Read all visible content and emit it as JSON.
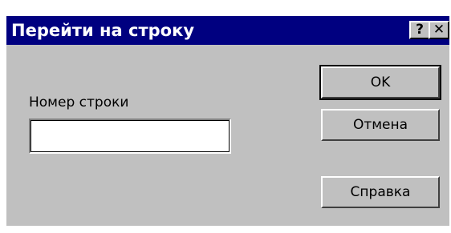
{
  "window": {
    "title": "Перейти на строку",
    "help_button": "?",
    "close_button": "✕"
  },
  "form": {
    "line_number_label": "Номер строки",
    "line_number_value": ""
  },
  "buttons": {
    "ok": "OK",
    "cancel": "Отмена",
    "help": "Справка"
  },
  "colors": {
    "titlebar": "#000080",
    "dialog_face": "#c0c0c0"
  }
}
